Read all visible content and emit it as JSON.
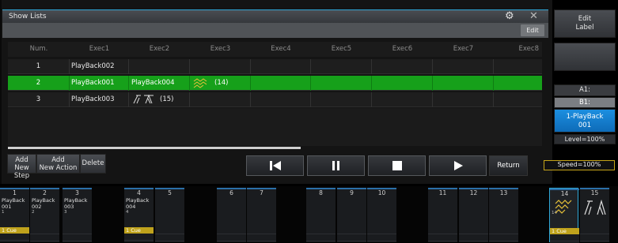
{
  "window": {
    "title": "Show Lists",
    "edit_label": "Edit"
  },
  "table": {
    "headers": [
      "Num.",
      "Exec1",
      "Exec2",
      "Exec3",
      "Exec4",
      "Exec5",
      "Exec6",
      "Exec7",
      "Exec8"
    ],
    "rows": [
      {
        "num": "1",
        "exec1": "PlayBack002",
        "exec2": "",
        "exec3": ""
      },
      {
        "num": "2",
        "exec1": "PlayBack001",
        "exec2": "PlayBack004",
        "exec3": "(14)"
      },
      {
        "num": "3",
        "exec1": "PlayBack003",
        "exec2": "(15)",
        "exec3": ""
      }
    ],
    "selected_row": 2
  },
  "buttons": {
    "add_step_1": "Add",
    "add_step_2": "New Step",
    "add_action_1": "Add",
    "add_action_2": "New Action",
    "delete": "Delete",
    "return": "Return"
  },
  "transport": [
    "prev",
    "pause",
    "stop",
    "play"
  ],
  "right_panel": {
    "edit_label_1": "Edit",
    "edit_label_2": "Label",
    "a1": "A1:",
    "b1": "B1:",
    "playback_1": "1-PlayBack",
    "playback_2": "001",
    "level": "Level=100%",
    "speed": "Speed=100%"
  },
  "executors": [
    {
      "num": "1",
      "name1": "PlayBack",
      "name2": "001",
      "sub": "1",
      "cue": "1 Cue"
    },
    {
      "num": "2",
      "name1": "PlayBack",
      "name2": "002",
      "sub": "2",
      "cue": ""
    },
    {
      "num": "3",
      "name1": "PlayBack",
      "name2": "003",
      "sub": "3",
      "cue": ""
    },
    {
      "num": "4",
      "name1": "PlayBack",
      "name2": "004",
      "sub": "4",
      "cue": "1 Cue"
    },
    {
      "num": "5",
      "name1": "",
      "name2": "",
      "sub": "",
      "cue": ""
    },
    {
      "num": "6",
      "name1": "",
      "name2": "",
      "sub": "",
      "cue": ""
    },
    {
      "num": "7",
      "name1": "",
      "name2": "",
      "sub": "",
      "cue": ""
    },
    {
      "num": "8",
      "name1": "",
      "name2": "",
      "sub": "",
      "cue": ""
    },
    {
      "num": "9",
      "name1": "",
      "name2": "",
      "sub": "",
      "cue": ""
    },
    {
      "num": "10",
      "name1": "",
      "name2": "",
      "sub": "",
      "cue": ""
    },
    {
      "num": "11",
      "name1": "",
      "name2": "",
      "sub": "",
      "cue": ""
    },
    {
      "num": "12",
      "name1": "",
      "name2": "",
      "sub": "",
      "cue": ""
    },
    {
      "num": "13",
      "name1": "",
      "name2": "",
      "sub": "",
      "cue": ""
    },
    {
      "num": "14",
      "name1": "",
      "name2": "",
      "sub": "14",
      "cue": "1 Cue"
    },
    {
      "num": "15",
      "name1": "",
      "name2": "",
      "sub": "",
      "cue": ""
    }
  ],
  "colors": {
    "selected_row": "#16a01a",
    "accent": "#2fa7d8",
    "cue": "#bfa21c"
  }
}
